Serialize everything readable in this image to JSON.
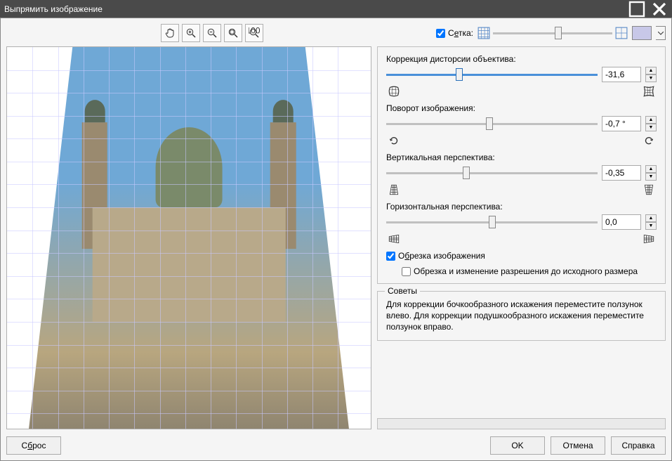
{
  "window": {
    "title": "Выпрямить изображение"
  },
  "toolbar": {
    "hand": "hand",
    "zoom_in": "zoom-in",
    "zoom_out": "zoom-out",
    "fit": "fit",
    "zoom_100": "100"
  },
  "grid": {
    "checkbox_checked": true,
    "label_pre": "С",
    "label_under": "е",
    "label_post": "тка:"
  },
  "controls": {
    "lens": {
      "label": "Коррекция дисторсии объектива:",
      "value": "-31,6"
    },
    "rotate": {
      "label": "Поворот изображения:",
      "value": "-0,7 °"
    },
    "vpersp": {
      "label": "Вертикальная перспектива:",
      "value": "-0,35"
    },
    "hpersp": {
      "label": "Горизонтальная перспектива:",
      "value": "0,0"
    },
    "crop": {
      "checked": true,
      "label_pre": "О",
      "label_under": "б",
      "label_post": "резка изображения",
      "sub_checked": false,
      "sub_label": "Обрезка и изменение разрешения до исходного размера"
    }
  },
  "tips": {
    "title": "Советы",
    "text": "Для коррекции бочкообразного искажения переместите ползунок влево. Для коррекции подушкообразного искажения переместите ползунок вправо."
  },
  "buttons": {
    "reset_pre": "С",
    "reset_under": "б",
    "reset_post": "рос",
    "ok": "OK",
    "cancel": "Отмена",
    "help": "Справка"
  }
}
